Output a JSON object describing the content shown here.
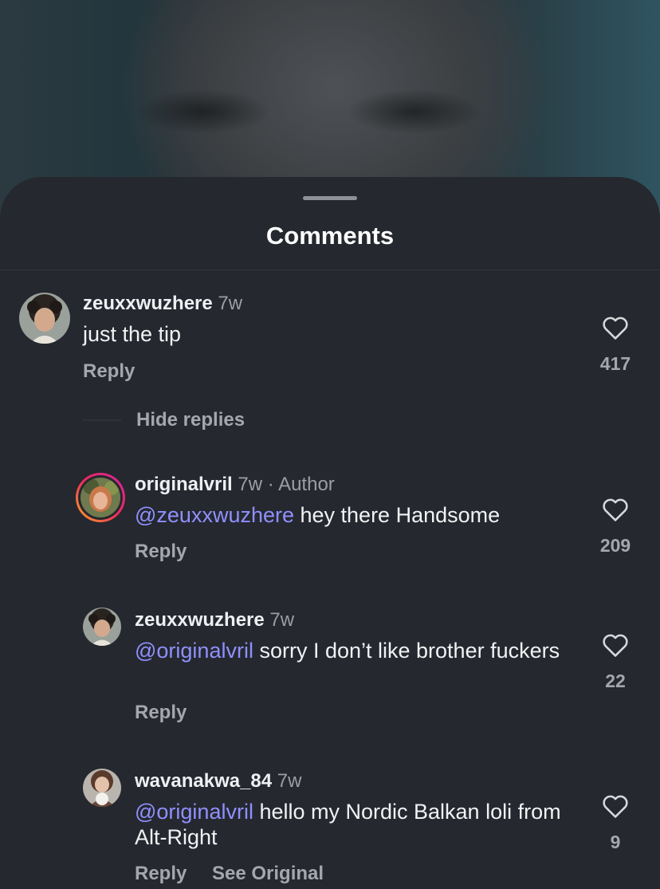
{
  "sheet": {
    "title": "Comments"
  },
  "comments": [
    {
      "username": "zeuxxwuzhere",
      "time": "7w",
      "text": "just the tip",
      "reply_label": "Reply",
      "likes": "417"
    }
  ],
  "thread": {
    "hide_replies_label": "Hide replies"
  },
  "replies": [
    {
      "username": "originalvril",
      "time": "7w",
      "author_tag": "· Author",
      "mention": "@zeuxxwuzhere",
      "text": " hey there Handsome",
      "reply_label": "Reply",
      "likes": "209"
    },
    {
      "username": "zeuxxwuzhere",
      "time": "7w",
      "mention": "@originalvril",
      "text": " sorry I don’t like brother fuckers",
      "reply_label": "Reply",
      "likes": "22"
    },
    {
      "username": "wavanakwa_84",
      "time": "7w",
      "mention": "@originalvril",
      "text": " hello my Nordic Balkan loli from Alt-Right",
      "reply_label": "Reply",
      "see_original_label": "See Original",
      "likes": "9"
    }
  ],
  "colors": {
    "sheet_background": "#25282e",
    "mention": "#8f90ff",
    "story_ring_start": "#f9a825",
    "story_ring_end": "#d6249f"
  },
  "icons": {
    "like": "heart-outline-icon"
  }
}
